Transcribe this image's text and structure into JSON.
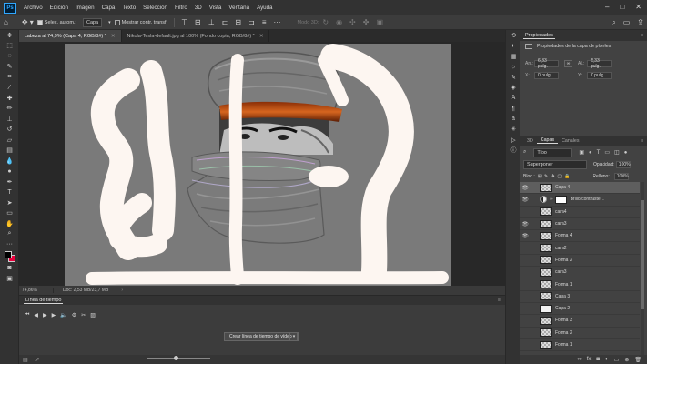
{
  "menubar": {
    "app_badge": "Ps",
    "items": [
      "Archivo",
      "Edición",
      "Imagen",
      "Capa",
      "Texto",
      "Selección",
      "Filtro",
      "3D",
      "Vista",
      "Ventana",
      "Ayuda"
    ]
  },
  "options": {
    "auto_select_label": "Selec. autom.:",
    "auto_select_target": "Capa",
    "transform_label": "Mostrar contr. transf.",
    "mode3d_label": "Modo 3D:"
  },
  "doc_tabs": [
    {
      "label": "cabeza al 74,9% (Capa 4, RGB/8#) *"
    },
    {
      "label": "Nikola-Tesla-default.jpg al 100% (Fondo copia, RGB/8#) *"
    }
  ],
  "status": {
    "zoom": "74,86%",
    "doc_info": "Doc: 2,53 MB/23,7 MB"
  },
  "timeline": {
    "tab": "Línea de tiempo",
    "create_button": "Crear línea de tiempo de vídeo"
  },
  "properties": {
    "tab": "Propiedades",
    "title": "Propiedades de la capa de píxeles",
    "an_label": "An.:",
    "an_value": "6,83 pulg.",
    "al_label": "Al.:",
    "al_value": "5,33 pulg.",
    "x_label": "X:",
    "x_value": "0 pulg.",
    "y_label": "Y:",
    "y_value": "0 pulg."
  },
  "layers_panel": {
    "tabs": [
      "3D",
      "Capas",
      "Canales"
    ],
    "filter": "Tipo",
    "blend_mode": "Superponer",
    "opacity_label": "Opacidad:",
    "opacity_value": "100%",
    "lock_label": "Bloq.:",
    "fill_label": "Relleno:",
    "fill_value": "100%",
    "layers": [
      {
        "name": "Capa 4",
        "visible": true,
        "selected": true
      },
      {
        "name": "Brillo/contraste 1",
        "visible": true,
        "selected": false
      },
      {
        "name": "cara4",
        "visible": false,
        "selected": false
      },
      {
        "name": "cara3",
        "visible": true,
        "selected": false
      },
      {
        "name": "Forma 4",
        "visible": true,
        "selected": false
      },
      {
        "name": "cara2",
        "visible": false,
        "selected": false
      },
      {
        "name": "Forma 2",
        "visible": false,
        "selected": false
      },
      {
        "name": "cara3",
        "visible": false,
        "selected": false
      },
      {
        "name": "Forma 1",
        "visible": false,
        "selected": false
      },
      {
        "name": "Capa 3",
        "visible": false,
        "selected": false
      },
      {
        "name": "Capa 2",
        "visible": false,
        "selected": false
      },
      {
        "name": "Forma 3",
        "visible": false,
        "selected": false
      },
      {
        "name": "Forma 2",
        "visible": false,
        "selected": false
      },
      {
        "name": "Forma 1",
        "visible": false,
        "selected": false
      }
    ]
  },
  "colors": {
    "foreground": "#000000",
    "background": "#e8003c",
    "brush_stroke": "#fdf6f1",
    "copper_band": "#c85a18"
  }
}
